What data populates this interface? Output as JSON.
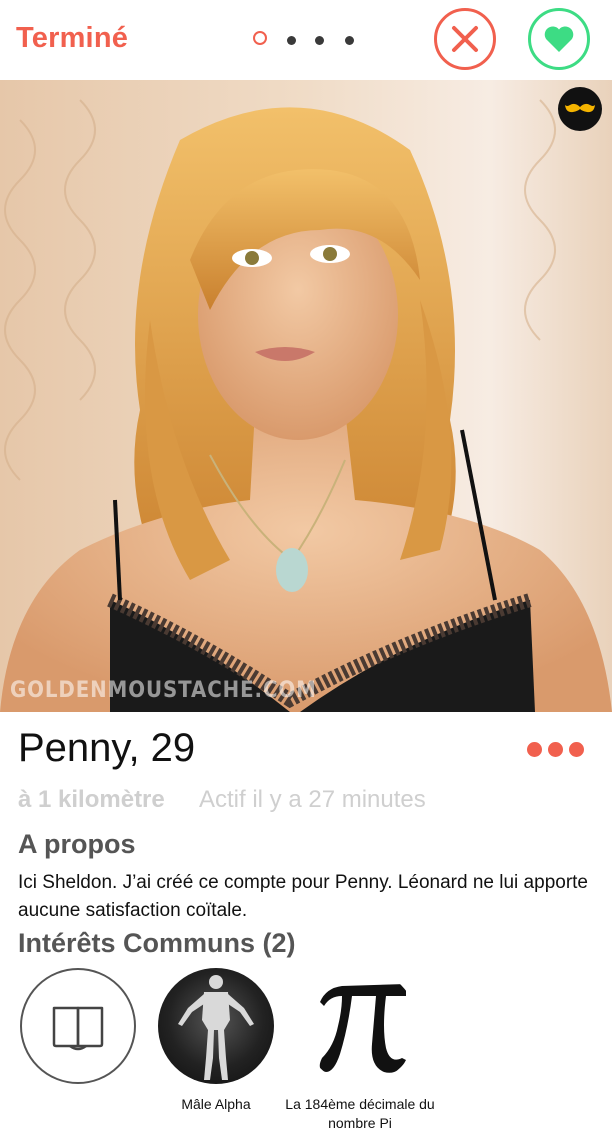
{
  "header": {
    "done_label": "Terminé",
    "pager": {
      "count": 4,
      "active_index": 0
    }
  },
  "photo": {
    "watermark": "GOLDENMOUSTACHE.COM"
  },
  "profile": {
    "name_age": "Penny, 29",
    "distance": "à 1 kilomètre",
    "last_active": "Actif il y a 27 minutes"
  },
  "about": {
    "title": "A propos",
    "text": "Ici Sheldon. J’ai créé ce compte pour Penny. Léonard ne lui apporte aucune satisfaction coïtale."
  },
  "interests": {
    "title": "Intérêts Communs (2)",
    "items": [
      {
        "icon": "book-icon",
        "label": ""
      },
      {
        "icon": "male-figure-icon",
        "label": "Mâle Alpha"
      },
      {
        "icon": "pi-icon",
        "label": "La 184ème décimale du nombre Pi"
      },
      {
        "icon": "blank",
        "label": ""
      }
    ]
  },
  "colors": {
    "accent": "#f1604e",
    "like": "#3ddc84",
    "moustache": "#f5b400"
  }
}
